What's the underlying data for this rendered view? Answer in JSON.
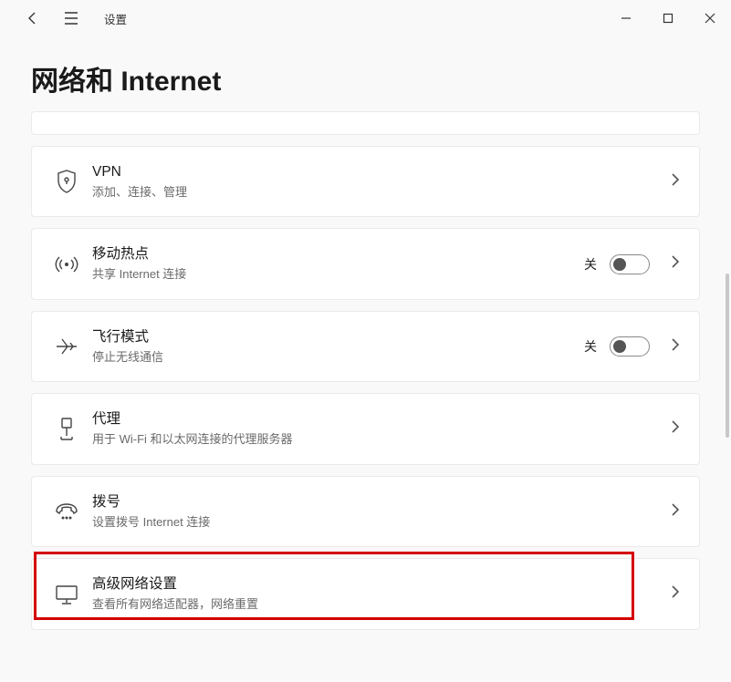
{
  "app": {
    "title": "设置"
  },
  "page": {
    "title": "网络和 Internet"
  },
  "toggle_off_label": "关",
  "items": {
    "vpn": {
      "title": "VPN",
      "desc": "添加、连接、管理"
    },
    "hotspot": {
      "title": "移动热点",
      "desc": "共享 Internet 连接"
    },
    "airplane": {
      "title": "飞行模式",
      "desc": "停止无线通信"
    },
    "proxy": {
      "title": "代理",
      "desc": "用于 Wi-Fi 和以太网连接的代理服务器"
    },
    "dialup": {
      "title": "拨号",
      "desc": "设置拨号 Internet 连接"
    },
    "advanced": {
      "title": "高级网络设置",
      "desc": "查看所有网络适配器，网络重置"
    }
  }
}
